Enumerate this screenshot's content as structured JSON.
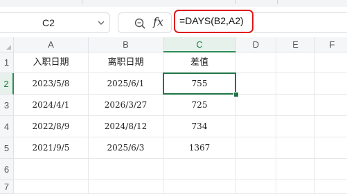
{
  "formula_bar": {
    "name_box": "C2",
    "fx_label": "fx",
    "formula": "=DAYS(B2,A2)"
  },
  "sheet": {
    "columns": [
      "A",
      "B",
      "C",
      "D",
      "E",
      "F"
    ],
    "rows": [
      "1",
      "2",
      "3",
      "4",
      "5",
      "6",
      "7"
    ],
    "header_row": [
      "入职日期",
      "离职日期",
      "差值"
    ],
    "data": [
      [
        "2023/5/8",
        "2025/6/1",
        "755"
      ],
      [
        "2024/4/1",
        "2026/3/27",
        "725"
      ],
      [
        "2022/8/9",
        "2024/8/12",
        "734"
      ],
      [
        "2021/9/5",
        "2025/6/3",
        "1367"
      ]
    ],
    "active_cell": "C2",
    "accent_color": "#217346",
    "highlight_color": "#e0161a"
  }
}
